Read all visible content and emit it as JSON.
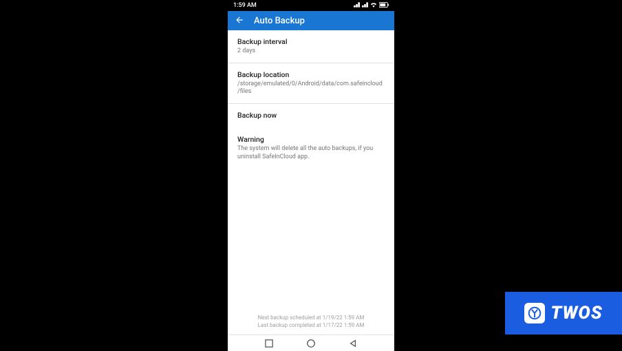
{
  "status": {
    "time": "1:59 AM"
  },
  "appbar": {
    "title": "Auto Backup"
  },
  "settings": {
    "interval": {
      "title": "Backup interval",
      "value": "2 days"
    },
    "location": {
      "title": "Backup location",
      "value": "/storage/emulated/0/Android/data/com.safeincloud/files"
    },
    "now": {
      "title": "Backup now"
    }
  },
  "warning": {
    "title": "Warning",
    "text": "The system will delete all the auto backups, if you uninstall SafeInCloud app."
  },
  "footer": {
    "next": "Next backup scheduled at 1/19/22 1:59 AM",
    "last": "Last backup completed at 1/17/22 1:59 AM"
  },
  "badge": {
    "text": "TWOS"
  }
}
